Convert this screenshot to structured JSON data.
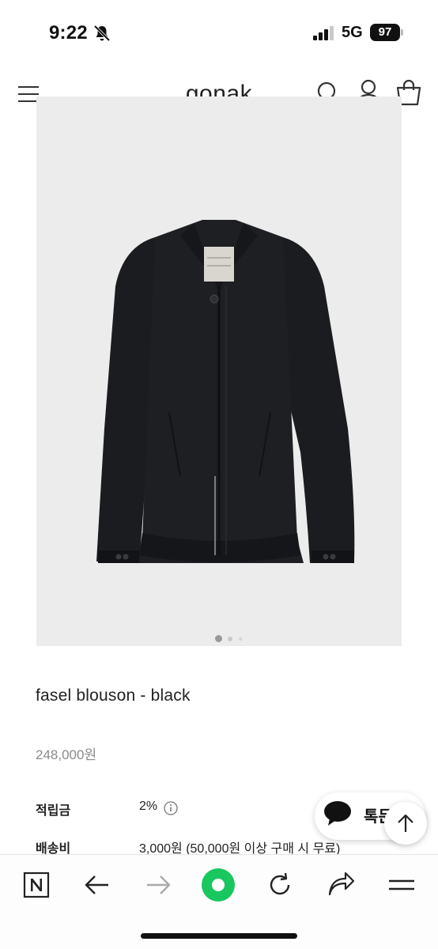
{
  "status_bar": {
    "time": "9:22",
    "network": "5G",
    "battery": "97"
  },
  "header": {
    "brand": "gonak"
  },
  "product": {
    "title": "fasel blouson - black",
    "price": "248,000원",
    "image_count": 3,
    "image_index": 1,
    "info": [
      {
        "label": "적립금",
        "value": "2%"
      },
      {
        "label": "배송비",
        "value": "3,000원 (50,000원 이상 구매 시 무료)"
      }
    ]
  },
  "floating": {
    "chat_label": "톡문"
  },
  "colors": {
    "accent_green": "#19c75f",
    "text": "#222222",
    "muted": "#8a8a8a",
    "image_bg": "#ececed"
  },
  "icons": [
    "bell-slash-icon",
    "signal-icon",
    "menu-icon",
    "search-icon",
    "user-icon",
    "cart-icon",
    "info-icon",
    "chat-bubble-icon",
    "arrow-up-icon",
    "naver-icon",
    "back-arrow-icon",
    "forward-arrow-icon",
    "green-dot-icon",
    "reload-icon",
    "share-icon",
    "hamburger-icon"
  ]
}
